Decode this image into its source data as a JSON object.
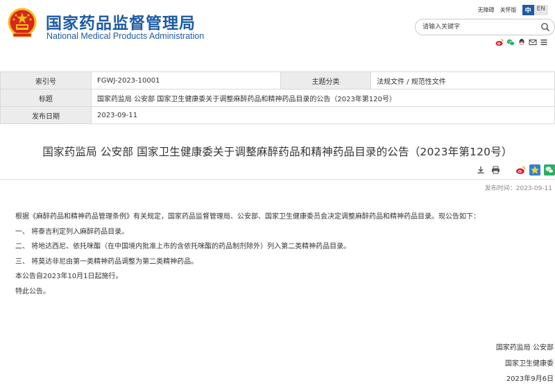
{
  "header": {
    "title_cn": "国家药品监督管理局",
    "title_en": "National Medical Products Administration",
    "accessibility_label": "无障碍",
    "care_label": "关怀版",
    "lang_cn": "中",
    "lang_en": "EN",
    "search_placeholder": "请输入关键字",
    "share_icons": [
      "weibo-icon",
      "wechat-icon",
      "qq-icon",
      "mail-icon",
      "menu-icon"
    ],
    "colors": {
      "brand": "#1d5aa6",
      "emblem_red": "#d7261c",
      "emblem_gold": "#f4c01a"
    }
  },
  "info": {
    "index_label": "索引号",
    "index_value": "FGWJ-2023-10001",
    "category_label": "主题分类",
    "category_value": "法规文件 / 规范性文件",
    "title_label": "标题",
    "title_value": "国家药监局 公安部 国家卫生健康委关于调整麻醉药品和精神药品目录的公告（2023年第120号）",
    "date_label": "发布日期",
    "date_value": "2023-09-11"
  },
  "article": {
    "title": "国家药监局 公安部 国家卫生健康委关于调整麻醉药品和精神药品目录的公告（2023年第120号）",
    "tools": [
      "download-icon",
      "print-icon",
      "weibo-icon",
      "qzone-icon",
      "wechat-icon"
    ],
    "pub_time": "发布时间：2023-09-11",
    "paragraphs": [
      "根据《麻醉药品和精神药品管理条例》有关规定，国家药品监督管理局、公安部、国家卫生健康委员会决定调整麻醉药品和精神药品目录。现公告如下：",
      "一、 将泰吉利定列入麻醉药品目录。",
      "二、 将地达西尼、依托咪酯（在中国境内批准上市的含依托咪酯的药品制剂除外）列入第二类精神药品目录。",
      "三、 将莫达非尼由第一类精神药品调整为第二类精神药品。",
      "本公告自2023年10月1日起施行。",
      "特此公告。"
    ],
    "signature": [
      "国家药监局 公安部",
      "国家卫生健康委",
      "2023年9月6日"
    ]
  }
}
